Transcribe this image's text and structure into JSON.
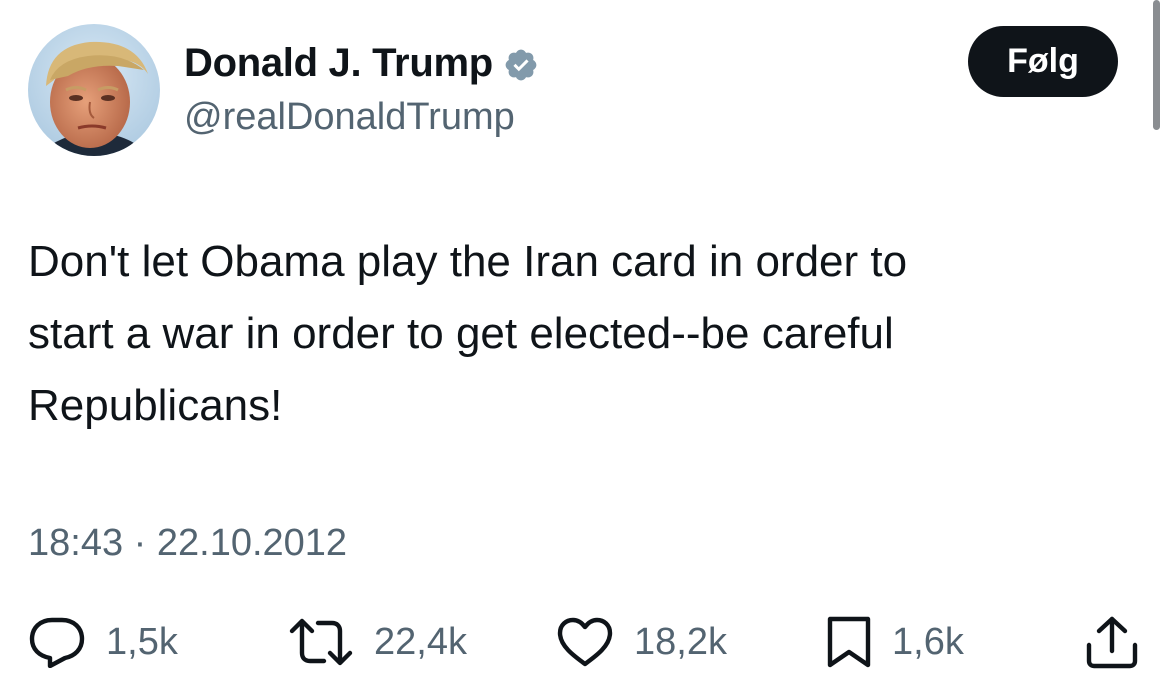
{
  "author": {
    "display_name": "Donald J. Trump",
    "handle": "@realDonaldTrump",
    "verified": true,
    "verified_badge_color": "#829aab"
  },
  "follow_button": {
    "label": "Følg"
  },
  "tweet": {
    "text": "Don't let Obama play the Iran card in order to\nstart a war in order to get elected--be careful\nRepublicans!",
    "timestamp": "18:43 · 22.10.2012"
  },
  "actions": {
    "replies": {
      "icon": "reply-icon",
      "count": "1,5k"
    },
    "retweets": {
      "icon": "retweet-icon",
      "count": "22,4k"
    },
    "likes": {
      "icon": "heart-icon",
      "count": "18,2k"
    },
    "bookmarks": {
      "icon": "bookmark-icon",
      "count": "1,6k"
    },
    "share": {
      "icon": "share-icon"
    }
  },
  "colors": {
    "text_primary": "#0f1419",
    "text_secondary": "#536471",
    "follow_bg": "#0f1419",
    "follow_text": "#ffffff",
    "background": "#ffffff"
  }
}
